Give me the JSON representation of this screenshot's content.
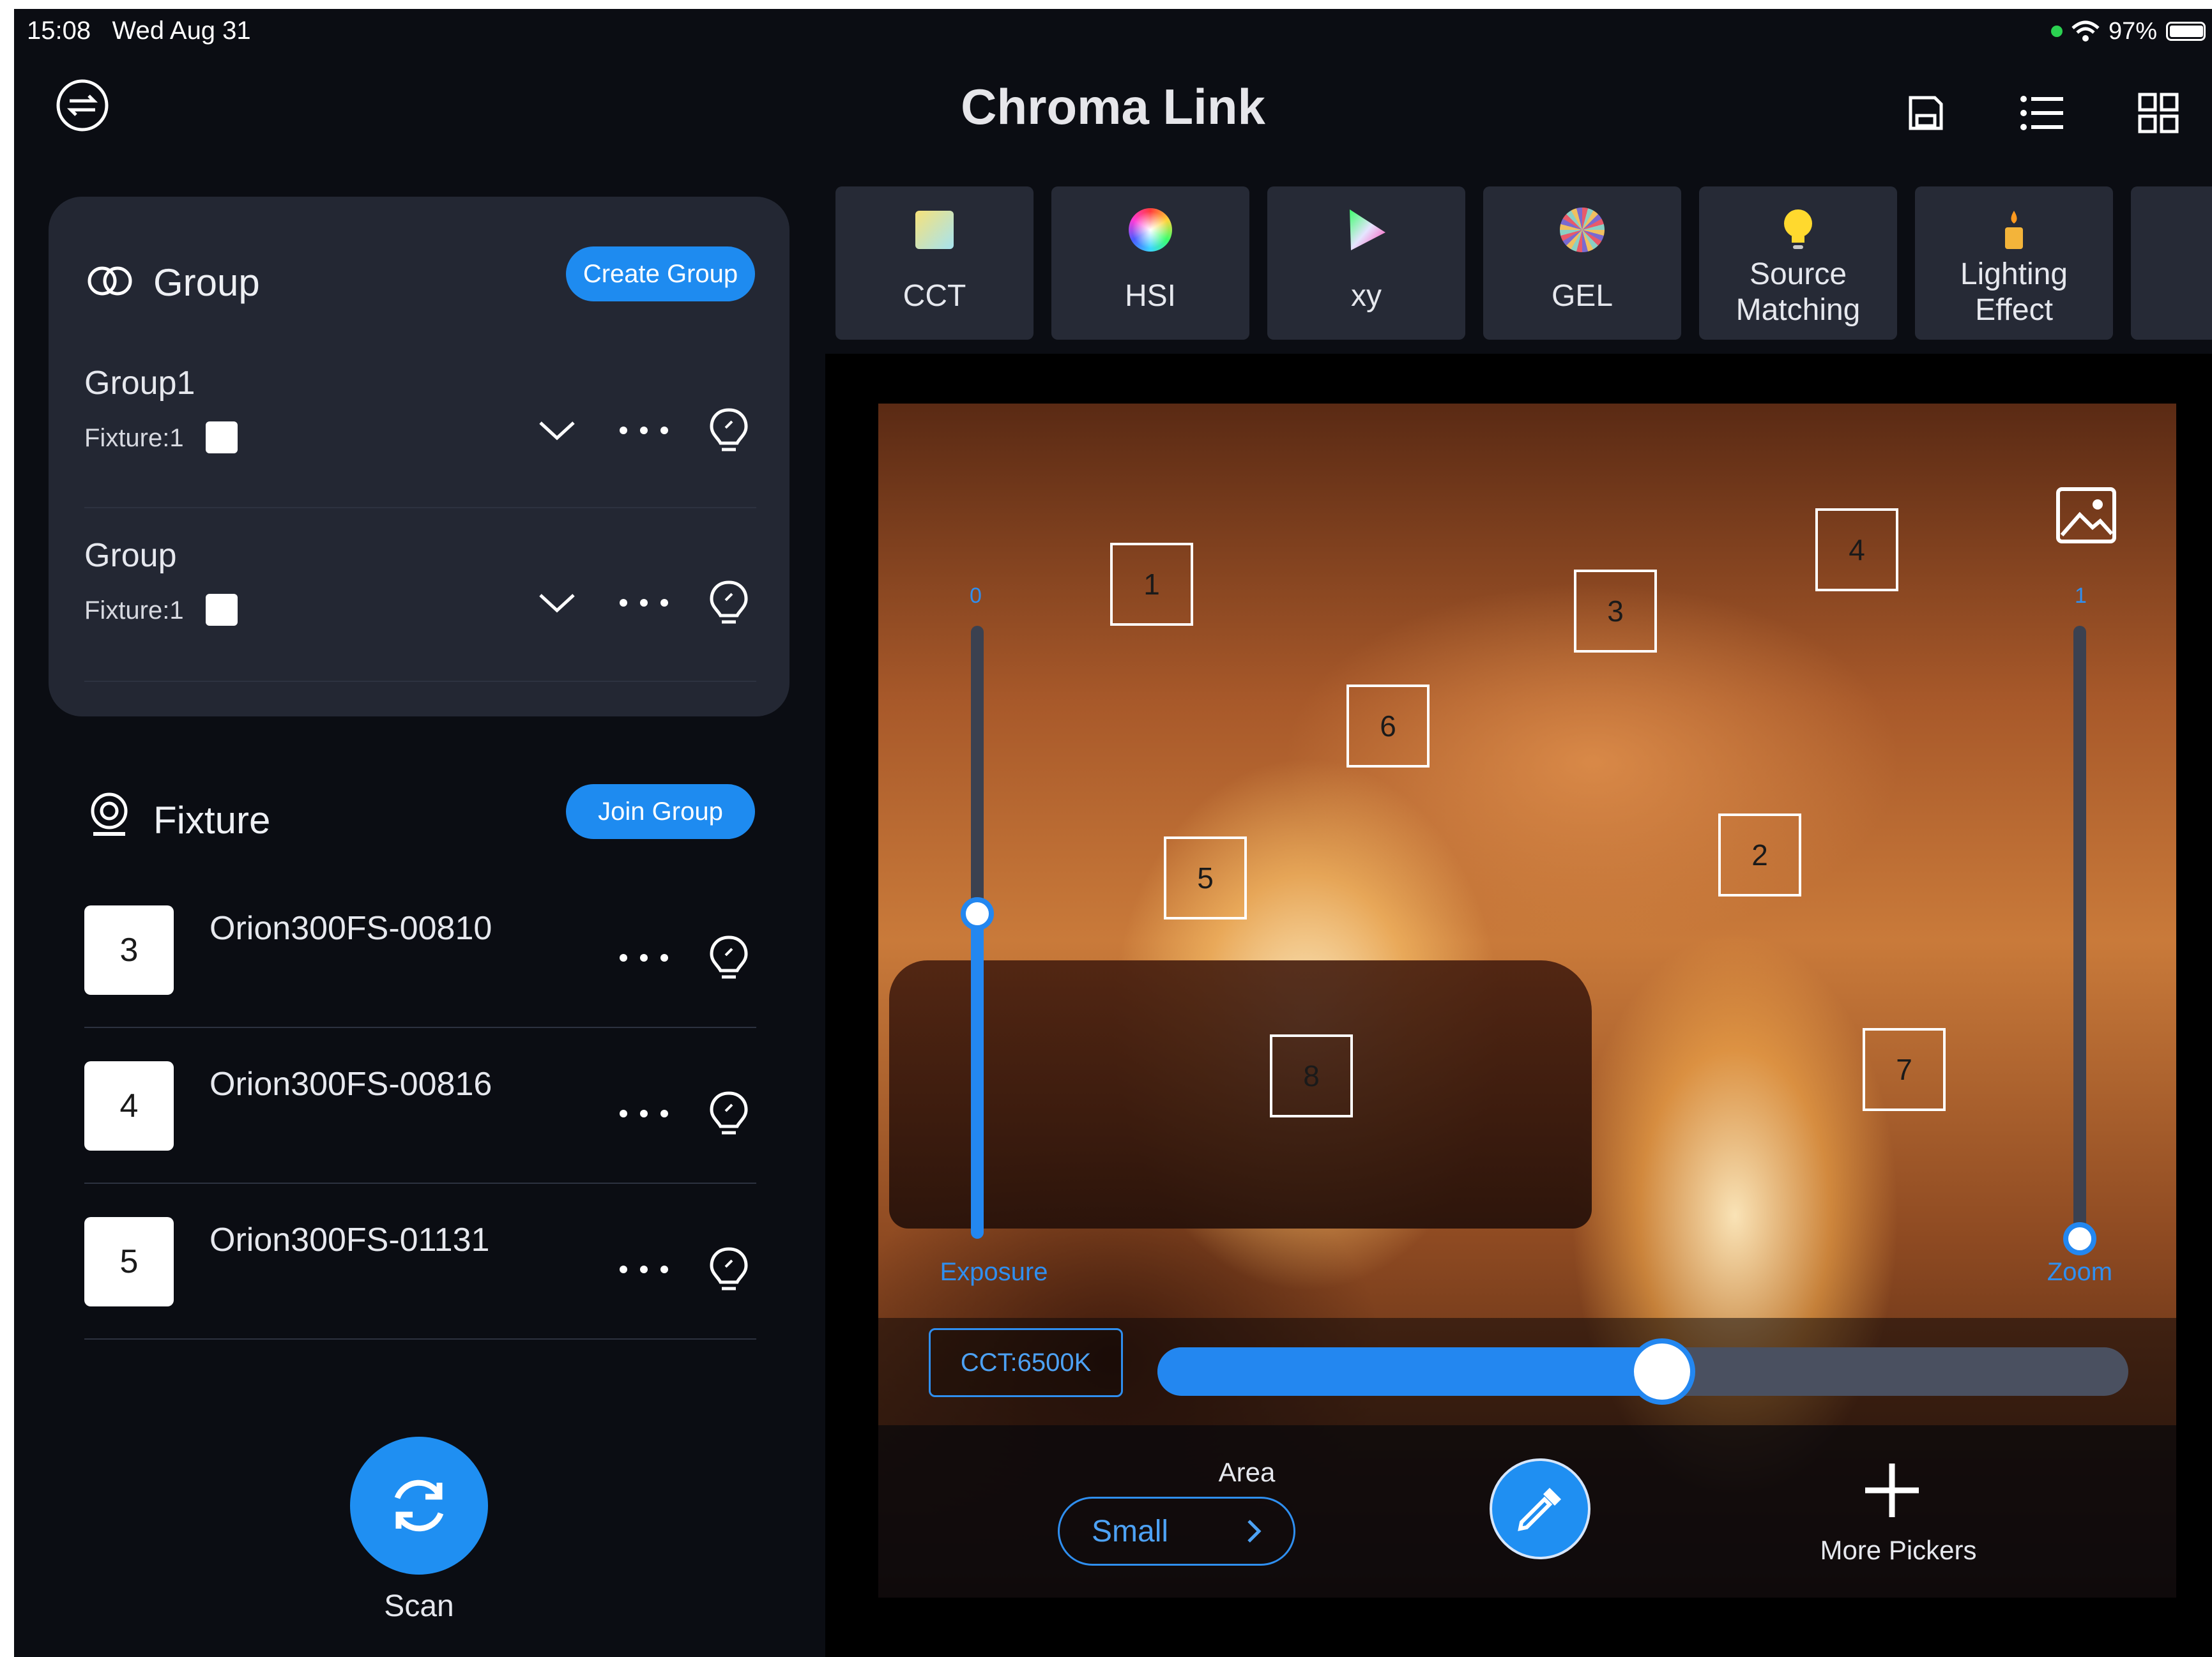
{
  "status_bar": {
    "time": "15:08",
    "date": "Wed Aug 31",
    "battery": "97%"
  },
  "header": {
    "title": "Chroma Link"
  },
  "group_section": {
    "title": "Group",
    "create_button": "Create Group",
    "groups": [
      {
        "name": "Group1",
        "fixture_count": "Fixture:1"
      },
      {
        "name": "Group",
        "fixture_count": "Fixture:1"
      }
    ]
  },
  "fixture_section": {
    "title": "Fixture",
    "join_button": "Join Group",
    "fixtures": [
      {
        "number": "3",
        "name": "Orion300FS-00810"
      },
      {
        "number": "4",
        "name": "Orion300FS-00816"
      },
      {
        "number": "5",
        "name": "Orion300FS-01131"
      }
    ]
  },
  "scan": {
    "label": "Scan"
  },
  "tabs": [
    {
      "label": "CCT",
      "icon": "cct-square-icon"
    },
    {
      "label": "HSI",
      "icon": "color-wheel-icon"
    },
    {
      "label": "xy",
      "icon": "gamut-triangle-icon"
    },
    {
      "label": "GEL",
      "icon": "gel-fan-icon"
    },
    {
      "label": "Source Matching",
      "icon": "bulb-icon"
    },
    {
      "label": "Lighting Effect",
      "icon": "candle-icon"
    }
  ],
  "picker_view": {
    "markers": [
      "1",
      "2",
      "3",
      "4",
      "5",
      "6",
      "7",
      "8"
    ],
    "exposure": {
      "label": "Exposure",
      "top_value": "0",
      "level": 0.53
    },
    "zoom": {
      "label": "Zoom",
      "top_value": "1",
      "level": 0.0
    },
    "cct_readout": "CCT:6500K",
    "cct_level": 0.52,
    "area_label": "Area",
    "area_value": "Small",
    "more_pickers": "More Pickers"
  },
  "colors": {
    "accent": "#1f8ff2",
    "panel": "#232733",
    "background": "#0b0d13"
  }
}
